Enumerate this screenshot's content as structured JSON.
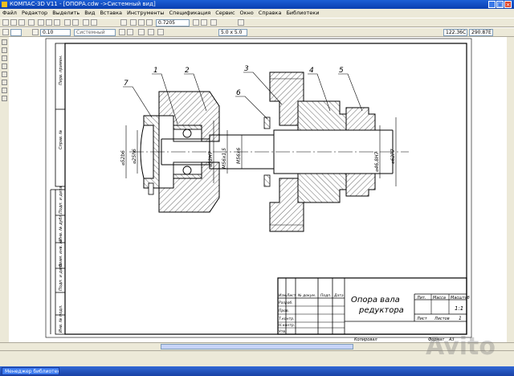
{
  "window": {
    "title": "КОМПАС-3D V11 - [ОПОРА.cdw ->Системный вид]"
  },
  "menu": [
    "Файл",
    "Редактор",
    "Выделить",
    "Вид",
    "Вставка",
    "Инструменты",
    "Спецификация",
    "Сервис",
    "Окно",
    "Справка",
    "Библиотеки"
  ],
  "toolbar": {
    "zoom_value": "0.7205",
    "step_value": "0.10",
    "view_value": "Системный",
    "grid_step": "5.0 x 5.0",
    "coord_x": "122.36С",
    "coord_y": "290.87Е"
  },
  "drawing": {
    "leader_numbers": [
      "1",
      "2",
      "3",
      "4",
      "5",
      "6",
      "7"
    ],
    "dim_labels": [
      "⌀52b6",
      "⌀25h6",
      "⌀52H7",
      "М56х1,5",
      "М56х6",
      "⌀46,8Н7",
      "⌀62Р7"
    ],
    "side_stamp": [
      "Перв. примен.",
      "Справ. №",
      "Подп. и дата",
      "Инв. № дубл.",
      "Взам. инв. №",
      "Подп. и дата",
      "Инв. № подл."
    ],
    "title_block": {
      "name_line1": "Опора вала",
      "name_line2": "редуктора",
      "head_cells": [
        "Лит.",
        "Масса",
        "Масштаб"
      ],
      "scale_value": "1:1",
      "sheet_label": "Лист",
      "sheets_label": "Листов",
      "sheets_value": "1",
      "change_headers": [
        "Изм.",
        "Лист",
        "№ докум.",
        "Подп.",
        "Дата"
      ],
      "role_labels": [
        "Разраб.",
        "Пров.",
        "Т.контр.",
        "Н.контр.",
        "Утв."
      ]
    },
    "bottom_labels": {
      "copied": "Копировал",
      "format": "Формат",
      "format_value": "А3"
    }
  },
  "taskbar": {
    "task_label": "Менеджер библиотек"
  },
  "watermark": "Avito"
}
